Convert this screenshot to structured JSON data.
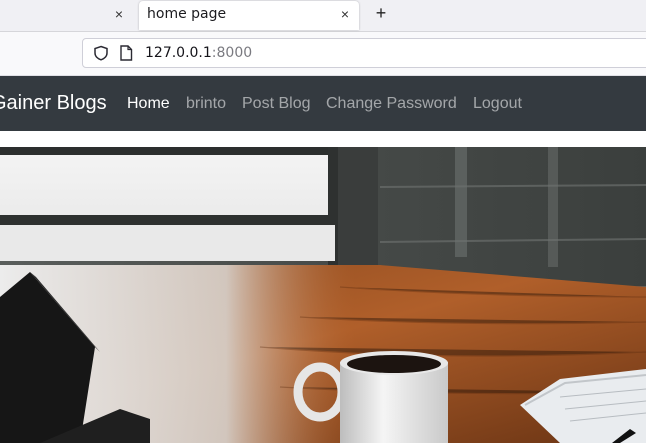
{
  "browser": {
    "active_tab_title": "home page",
    "url_host": "127.0.0.1",
    "url_port": ":8000",
    "close_glyph": "×",
    "new_tab_glyph": "+"
  },
  "site": {
    "brand": "Gainer Blogs",
    "nav": [
      {
        "label": "Home",
        "active": true
      },
      {
        "label": "brinto",
        "active": false
      },
      {
        "label": "Post Blog",
        "active": false
      },
      {
        "label": "Change Password",
        "active": false
      },
      {
        "label": "Logout",
        "active": false
      }
    ],
    "navbar_color": "#343a40"
  },
  "hero": {
    "description_icon": "coffee-desk-photo"
  }
}
